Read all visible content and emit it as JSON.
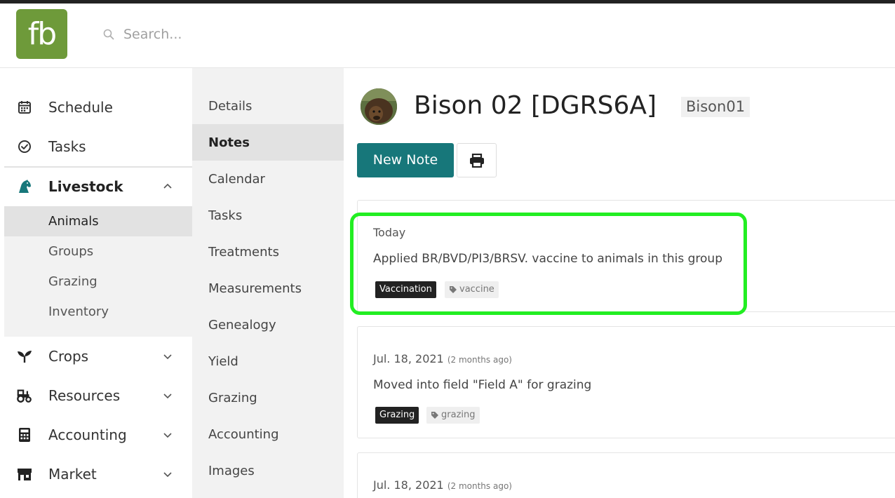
{
  "header": {
    "logo_text": "fb",
    "search_placeholder": "Search..."
  },
  "colors": {
    "brand_green": "#6e9a3a",
    "primary_teal": "#17777a",
    "highlight": "#22ee22"
  },
  "sidebar": {
    "items": [
      {
        "label": "Schedule",
        "icon": "calendar-icon"
      },
      {
        "label": "Tasks",
        "icon": "check-circle-icon"
      },
      {
        "label": "Livestock",
        "icon": "horse-icon",
        "expanded": true
      },
      {
        "label": "Crops",
        "icon": "seedling-icon"
      },
      {
        "label": "Resources",
        "icon": "tractor-icon"
      },
      {
        "label": "Accounting",
        "icon": "calculator-icon"
      },
      {
        "label": "Market",
        "icon": "store-icon"
      }
    ],
    "livestock_sub": [
      {
        "label": "Animals",
        "active": true
      },
      {
        "label": "Groups"
      },
      {
        "label": "Grazing"
      },
      {
        "label": "Inventory"
      }
    ]
  },
  "subnav": {
    "items": [
      "Details",
      "Notes",
      "Calendar",
      "Tasks",
      "Treatments",
      "Measurements",
      "Genealogy",
      "Yield",
      "Grazing",
      "Accounting",
      "Images"
    ],
    "active": "Notes"
  },
  "main": {
    "title": "Bison 02 [DGRS6A]",
    "tag_id": "Bison01",
    "new_note_label": "New Note",
    "notes": [
      {
        "date": "Today",
        "relative": "",
        "text": "Applied BR/BVD/PI3/BRSV. vaccine to animals in this group",
        "category": "Vaccination",
        "keyword": "vaccine"
      },
      {
        "date": "Jul. 18, 2021",
        "relative": "(2 months ago)",
        "text": "Moved into field \"Field A\" for grazing",
        "category": "Grazing",
        "keyword": "grazing"
      },
      {
        "date": "Jul. 18, 2021",
        "relative": "(2 months ago)",
        "text": "",
        "category": "",
        "keyword": ""
      }
    ]
  }
}
